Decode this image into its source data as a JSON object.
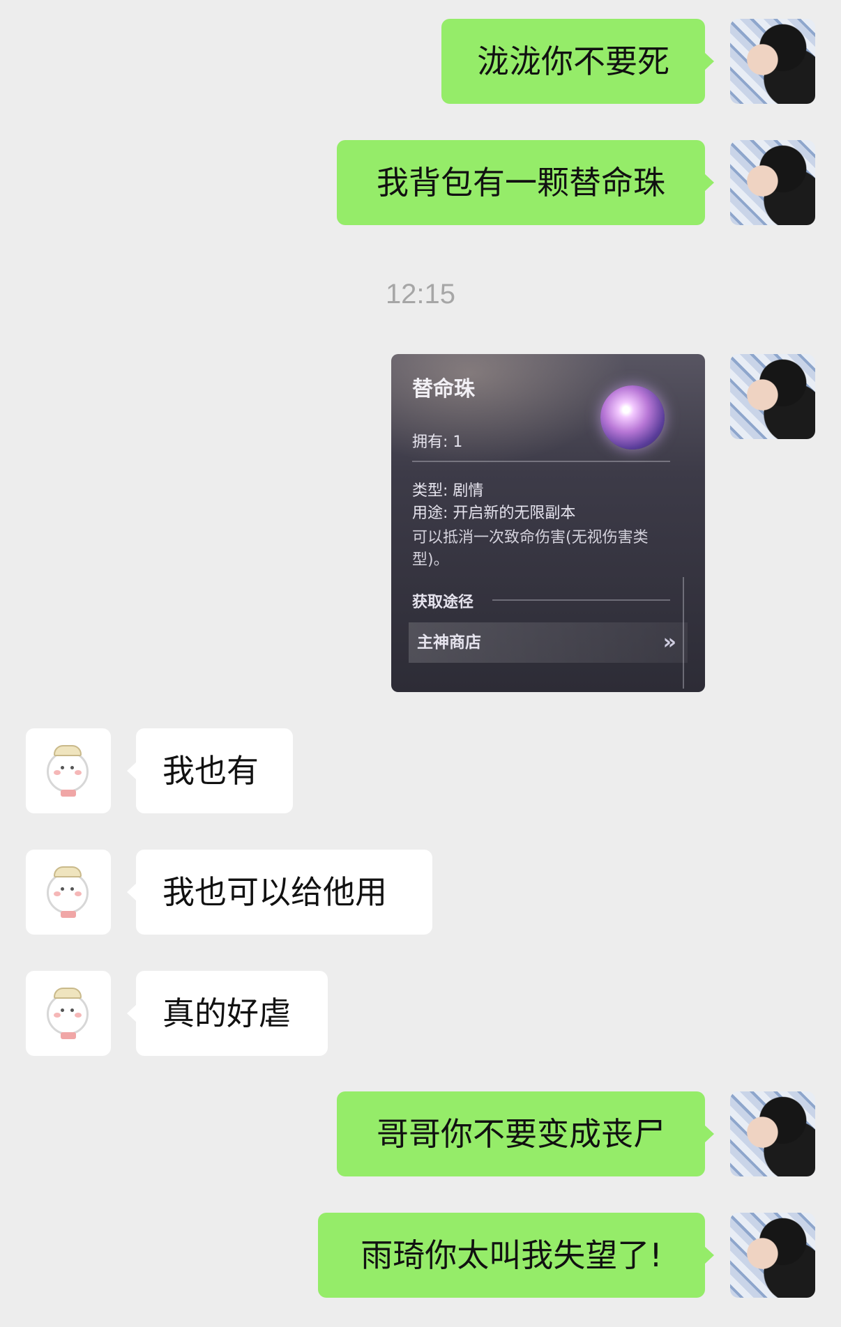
{
  "messages": [
    {
      "side": "me",
      "text": "泷泷你不要死"
    },
    {
      "side": "me",
      "text": "我背包有一颗替命珠"
    },
    {
      "side": "friend",
      "text": "我也有"
    },
    {
      "side": "friend",
      "text": "我也可以给他用"
    },
    {
      "side": "friend",
      "text": "真的好虐"
    },
    {
      "side": "me",
      "text": "哥哥你不要变成丧尸"
    },
    {
      "side": "me",
      "text": "雨琦你太叫我失望了!"
    }
  ],
  "timestamp": "12:15",
  "item_card": {
    "title": "替命珠",
    "owned": "拥有: 1",
    "type": "类型: 剧情",
    "use": "用途: 开启新的无限副本",
    "description": "可以抵消一次致命伤害(无视伤害类型)。",
    "source_label": "获取途径",
    "source": "主神商店",
    "arrow": "»"
  },
  "colors": {
    "background": "#ededed",
    "my_bubble": "#95ec69",
    "friend_bubble": "#ffffff",
    "timestamp": "#a6a6a6"
  }
}
